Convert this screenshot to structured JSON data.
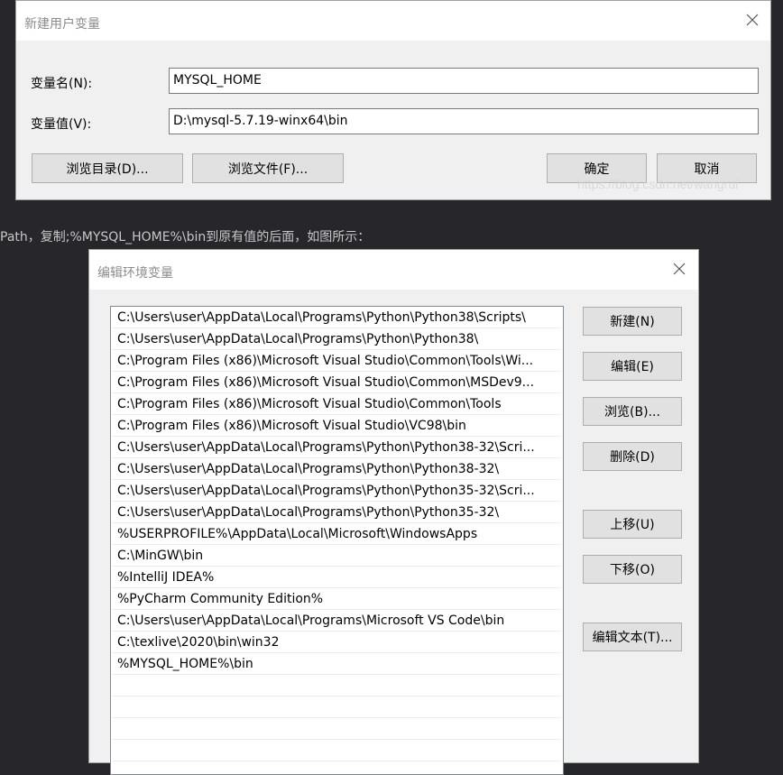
{
  "new_user_var_dialog": {
    "title": "新建用户变量",
    "name_label": "变量名(N):",
    "name_value": "MYSQL_HOME",
    "value_label": "变量值(V):",
    "value_value": "D:\\mysql-5.7.19-winx64\\bin",
    "browse_dir_label": "浏览目录(D)...",
    "browse_file_label": "浏览文件(F)...",
    "ok_label": "确定",
    "cancel_label": "取消"
  },
  "watermark": "https://blog.csdn.net/wangrui",
  "note_text": "Path，复制;%MYSQL_HOME%\\bin到原有值的后面，如图所示：",
  "edit_env_dialog": {
    "title": "编辑环境变量",
    "paths": [
      "C:\\Users\\user\\AppData\\Local\\Programs\\Python\\Python38\\Scripts\\",
      "C:\\Users\\user\\AppData\\Local\\Programs\\Python\\Python38\\",
      "C:\\Program Files (x86)\\Microsoft Visual Studio\\Common\\Tools\\Wi...",
      "C:\\Program Files (x86)\\Microsoft Visual Studio\\Common\\MSDev9...",
      "C:\\Program Files (x86)\\Microsoft Visual Studio\\Common\\Tools",
      "C:\\Program Files (x86)\\Microsoft Visual Studio\\VC98\\bin",
      "C:\\Users\\user\\AppData\\Local\\Programs\\Python\\Python38-32\\Scri...",
      "C:\\Users\\user\\AppData\\Local\\Programs\\Python\\Python38-32\\",
      "C:\\Users\\user\\AppData\\Local\\Programs\\Python\\Python35-32\\Scri...",
      "C:\\Users\\user\\AppData\\Local\\Programs\\Python\\Python35-32\\",
      "%USERPROFILE%\\AppData\\Local\\Microsoft\\WindowsApps",
      "C:\\MinGW\\bin",
      "%IntelliJ IDEA%",
      "%PyCharm Community Edition%",
      "C:\\Users\\user\\AppData\\Local\\Programs\\Microsoft VS Code\\bin",
      "C:\\texlive\\2020\\bin\\win32",
      "%MYSQL_HOME%\\bin"
    ],
    "buttons": {
      "new": "新建(N)",
      "edit": "编辑(E)",
      "browse": "浏览(B)...",
      "delete": "删除(D)",
      "move_up": "上移(U)",
      "move_down": "下移(O)",
      "edit_text": "编辑文本(T)..."
    }
  }
}
